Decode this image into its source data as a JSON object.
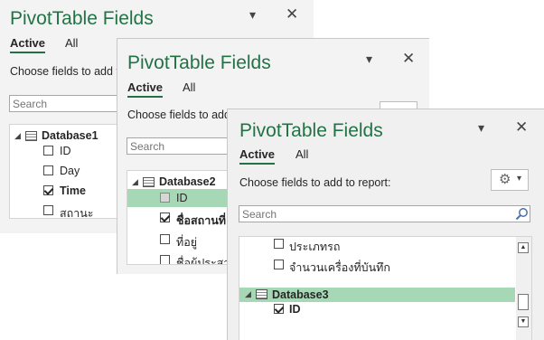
{
  "panels": [
    {
      "title": "PivotTable Fields",
      "tabs": [
        "Active",
        "All"
      ],
      "description": "Choose fields to add to",
      "search_placeholder": "Search",
      "database": "Database1",
      "fields": [
        {
          "label": "ID",
          "checked": false
        },
        {
          "label": "Day",
          "checked": false
        },
        {
          "label": "Time",
          "checked": true
        },
        {
          "label": "สถานะ",
          "checked": false
        }
      ]
    },
    {
      "title": "PivotTable Fields",
      "tabs": [
        "Active",
        "All"
      ],
      "description": "Choose fields to add",
      "search_placeholder": "Search",
      "database": "Database2",
      "fields": [
        {
          "label": "ID",
          "checked": false
        },
        {
          "label": "ชื่อสถานที่",
          "checked": true
        },
        {
          "label": "ที่อยู่",
          "checked": false
        },
        {
          "label": "ชื่อผู้ประสาน",
          "checked": false
        }
      ]
    },
    {
      "title": "PivotTable Fields",
      "tabs": [
        "Active",
        "All"
      ],
      "description": "Choose fields to add to report:",
      "search_placeholder": "Search",
      "fields_above": [
        {
          "label": "ประเภทรถ",
          "checked": false
        },
        {
          "label": "จำนวนเครื่องที่บันทึก",
          "checked": false
        }
      ],
      "database": "Database3",
      "fields": [
        {
          "label": "ID",
          "checked": true
        }
      ]
    }
  ],
  "colors": {
    "accent": "#217346",
    "highlight": "#a7d8b6"
  },
  "icons": [
    "chevron-down-icon",
    "close-icon",
    "search-icon",
    "gear-icon",
    "table-icon",
    "collapse-triangle-icon"
  ]
}
